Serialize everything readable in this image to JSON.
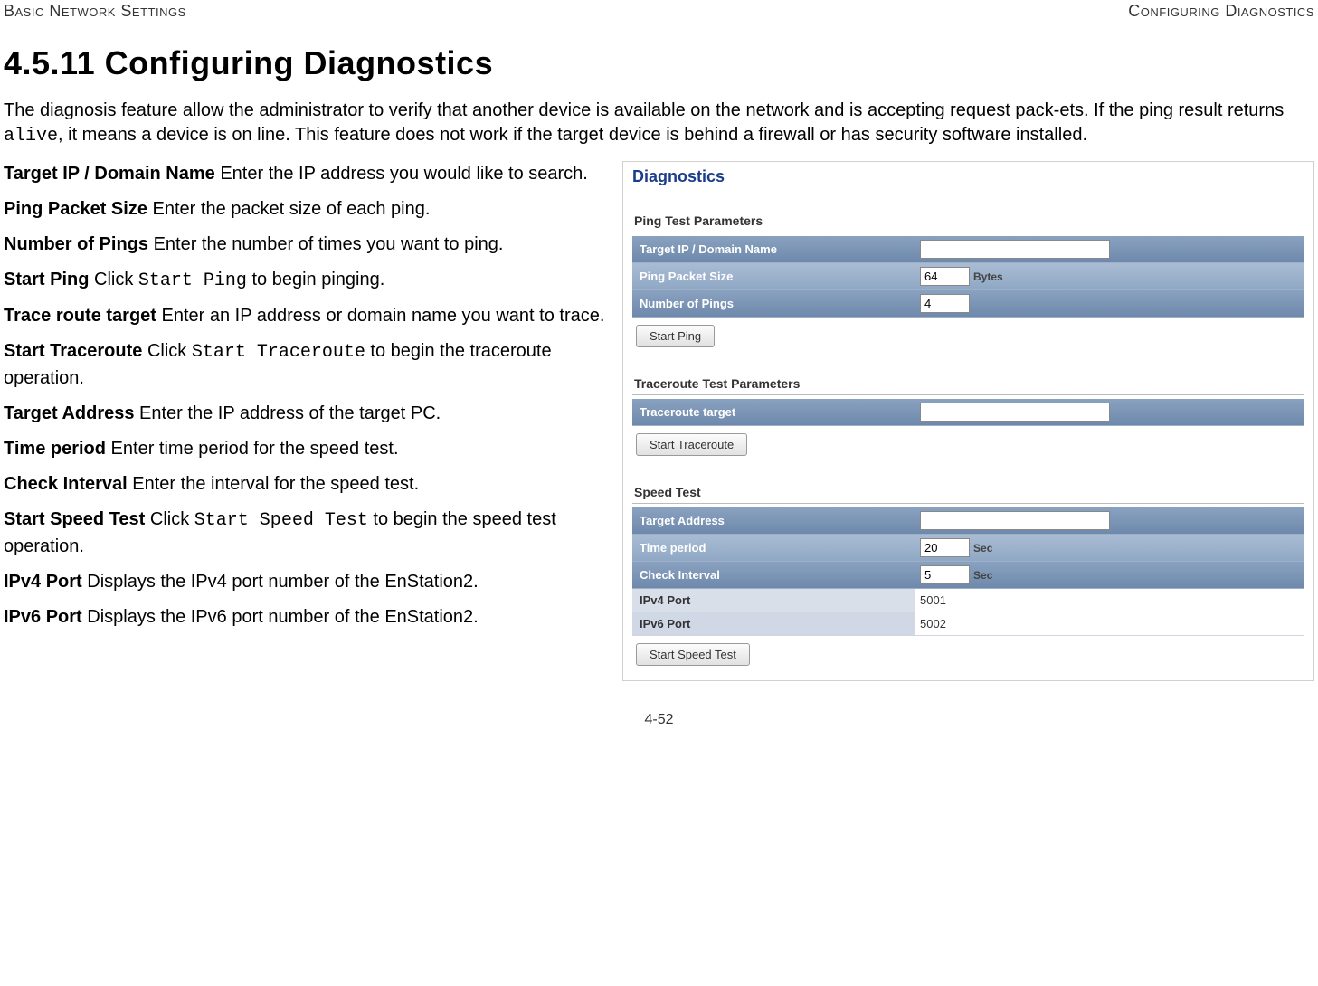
{
  "header": {
    "left": "Basic Network Settings",
    "right": "Configuring Diagnostics"
  },
  "title": "4.5.11 Configuring Diagnostics",
  "intro_parts": {
    "p1": "The diagnosis feature allow the administrator to verify that another device is available on the network and is accepting request pack-ets. If the ping result returns ",
    "code": "alive",
    "p2": ", it means a device is on line. This feature does not work if the target device is behind a firewall or has security software installed."
  },
  "definitions": [
    {
      "label": "Target IP / Domain Name",
      "text": "   Enter the IP address you would like to search."
    },
    {
      "label": "Ping Packet Size",
      "text": "  Enter the packet size of each ping."
    },
    {
      "label": "Number of Pings",
      "text": "  Enter the number of times you want to ping."
    },
    {
      "label": "Start Ping",
      "text_pre": "  Click ",
      "code": "Start Ping",
      "text_post": " to begin pinging."
    },
    {
      "label": "Trace route target",
      "text": "  Enter an IP address or domain name you want to trace."
    },
    {
      "label": "Start Traceroute",
      "text_pre": "  Click ",
      "code": "Start Traceroute",
      "text_post": " to begin the traceroute operation."
    },
    {
      "label": "Target Address",
      "text": "  Enter the IP address of the target PC."
    },
    {
      "label": "Time period",
      "text": "  Enter time period for the speed test."
    },
    {
      "label": "Check Interval",
      "text": "  Enter the interval for the speed test."
    },
    {
      "label": "Start Speed Test",
      "text_pre": "  Click ",
      "code": "Start Speed Test",
      "text_post": " to begin the speed test operation."
    },
    {
      "label": "IPv4 Port",
      "text": "  Displays the IPv4 port number of the EnStation2."
    },
    {
      "label": "IPv6 Port",
      "text": "  Displays the IPv6 port number of the EnStation2."
    }
  ],
  "panel": {
    "title": "Diagnostics",
    "ping": {
      "section_title": "Ping Test Parameters",
      "rows": {
        "target_label": "Target IP / Domain Name",
        "target_value": "",
        "size_label": "Ping Packet Size",
        "size_value": "64",
        "size_unit": "Bytes",
        "count_label": "Number of Pings",
        "count_value": "4"
      },
      "button": "Start Ping"
    },
    "trace": {
      "section_title": "Traceroute Test Parameters",
      "rows": {
        "target_label": "Traceroute target",
        "target_value": ""
      },
      "button": "Start Traceroute"
    },
    "speed": {
      "section_title": "Speed Test",
      "rows": {
        "target_label": "Target Address",
        "target_value": "",
        "time_label": "Time period",
        "time_value": "20",
        "time_unit": "Sec",
        "interval_label": "Check Interval",
        "interval_value": "5",
        "interval_unit": "Sec",
        "ipv4_label": "IPv4 Port",
        "ipv4_value": "5001",
        "ipv6_label": "IPv6 Port",
        "ipv6_value": "5002"
      },
      "button": "Start Speed Test"
    }
  },
  "footer": "4-52"
}
